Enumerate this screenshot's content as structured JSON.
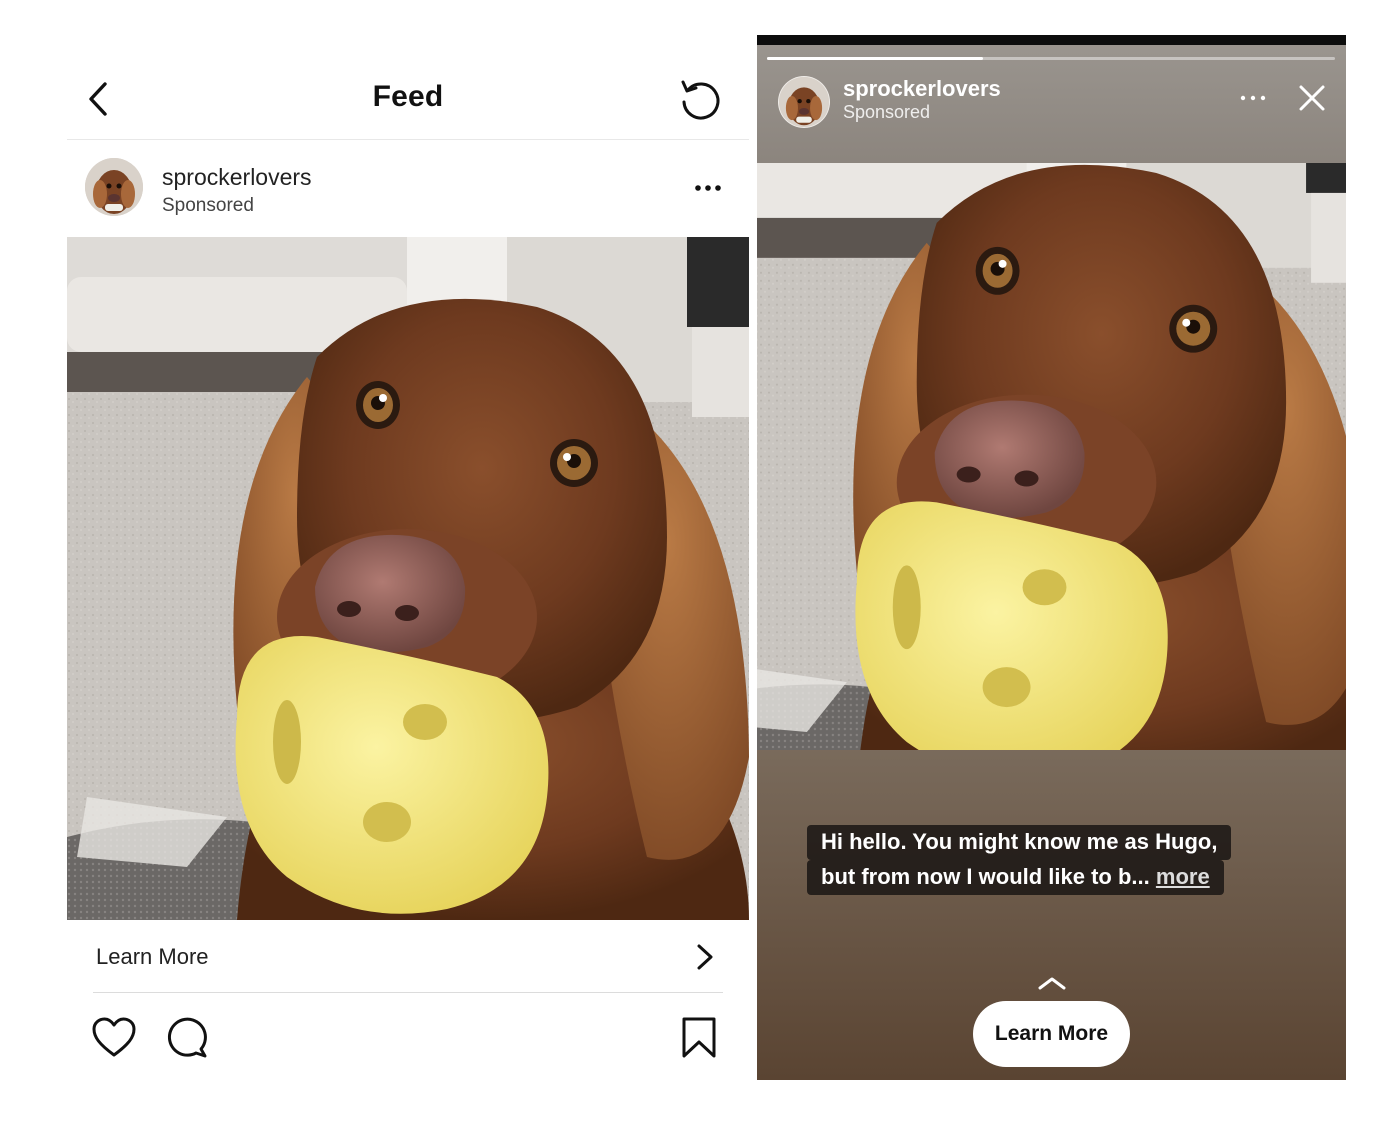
{
  "feed": {
    "header": {
      "title": "Feed"
    },
    "post": {
      "username": "sprockerlovers",
      "sponsored_label": "Sponsored",
      "cta_label": "Learn More"
    }
  },
  "story": {
    "progress": 0.38,
    "username": "sprockerlovers",
    "sponsored_label": "Sponsored",
    "caption_line1": "Hi hello. You might know me as Hugo,",
    "caption_line2": "but from now I would like to b...",
    "caption_more": "more",
    "cta_label": "Learn More"
  },
  "icons": {
    "back": "chevron-left-icon",
    "refresh": "refresh-icon",
    "more": "more-horizontal-icon",
    "chevron_right": "chevron-right-icon",
    "like": "heart-icon",
    "comment": "comment-icon",
    "save": "bookmark-icon",
    "close": "close-icon",
    "swipe_up": "chevron-up-icon"
  }
}
